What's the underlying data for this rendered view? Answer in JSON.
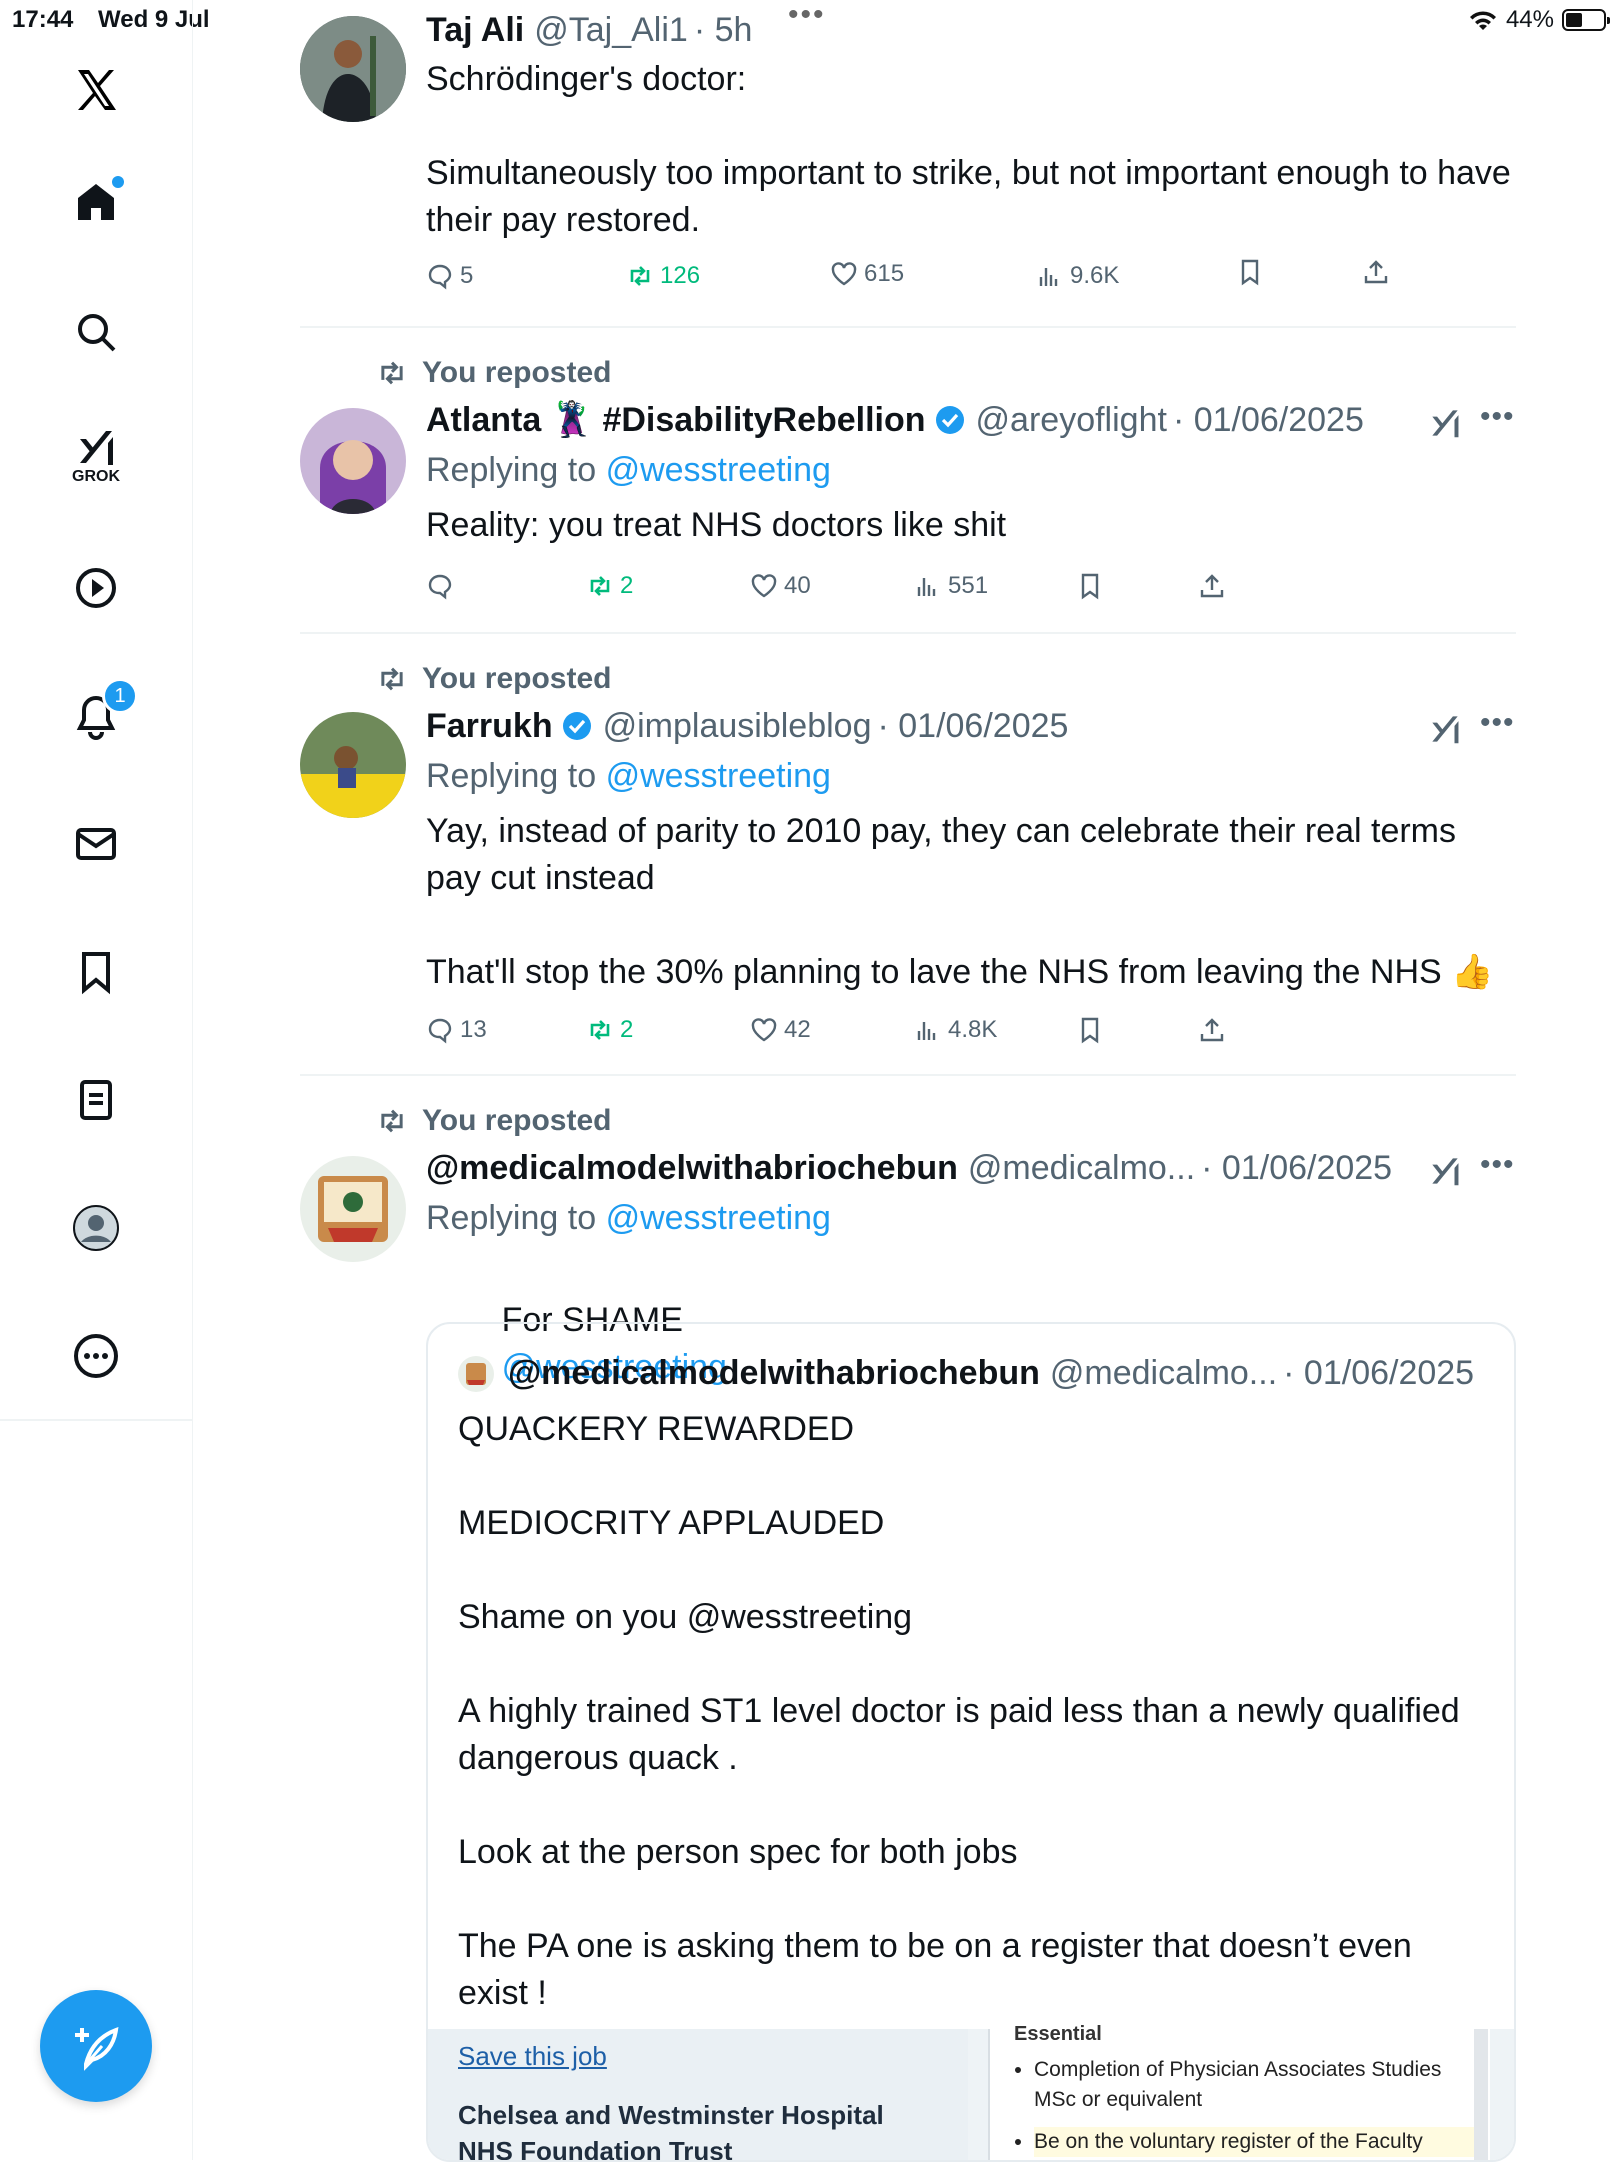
{
  "status": {
    "time": "17:44",
    "date": "Wed 9 Jul",
    "battery": "44%"
  },
  "sidebar": {
    "grok_label": "GROK",
    "notifications_badge": "1"
  },
  "tweets": [
    {
      "name": "Taj Ali",
      "handle": "@Taj_Ali1",
      "time": "· 5h",
      "text": "Schrödinger's doctor:\n\nSimultaneously too important to strike, but not important enough to have their pay restored.",
      "replies": "5",
      "reposts": "126",
      "likes": "615",
      "views": "9.6K"
    },
    {
      "repost_label": "You reposted",
      "name": "Atlanta 🦹 #DisabilityRebellion",
      "handle": "@areyoflight",
      "time": "· 01/06/2025",
      "replying_prefix": "Replying to",
      "replying_to": "@wesstreeting",
      "text": "Reality: you treat NHS doctors like shit",
      "replies": "",
      "reposts": "2",
      "likes": "40",
      "views": "551"
    },
    {
      "repost_label": "You reposted",
      "name": "Farrukh",
      "handle": "@implausibleblog",
      "time": "· 01/06/2025",
      "replying_prefix": "Replying to",
      "replying_to": "@wesstreeting",
      "text": "Yay, instead of parity to 2010 pay, they can celebrate their real terms pay cut instead\n\nThat'll stop the 30% planning to lave the NHS from leaving the NHS 👍",
      "replies": "13",
      "reposts": "2",
      "likes": "42",
      "views": "4.8K"
    },
    {
      "repost_label": "You reposted",
      "name": "@medicalmodelwithabriochebun",
      "handle": "@medicalmo...",
      "time": "· 01/06/2025",
      "replying_prefix": "Replying to",
      "replying_to": "@wesstreeting",
      "text_prefix": "For SHAME",
      "text_mention": "@wesstreeting"
    }
  ],
  "quote": {
    "name": "@medicalmodelwithabriochebun",
    "handle": "@medicalmo...",
    "time": "· 01/06/2025",
    "text": "QUACKERY REWARDED\n\nMEDIOCRITY APPLAUDED\n\nShame on you @wesstreeting\n\nA highly trained ST1 level doctor is paid less than a newly qualified dangerous quack .\n\nLook at the person spec for both jobs\n\nThe PA one is asking them to be on a register that doesn’t even exist !",
    "image": {
      "save_link": "Save this job",
      "org": "Chelsea and Westminster Hospital\nNHS Foundation Trust",
      "essential": "Essential",
      "bullets": [
        "Completion of Physician Associates Studies MSc or equivalent",
        "Be on the voluntary register of the Faculty"
      ]
    }
  }
}
